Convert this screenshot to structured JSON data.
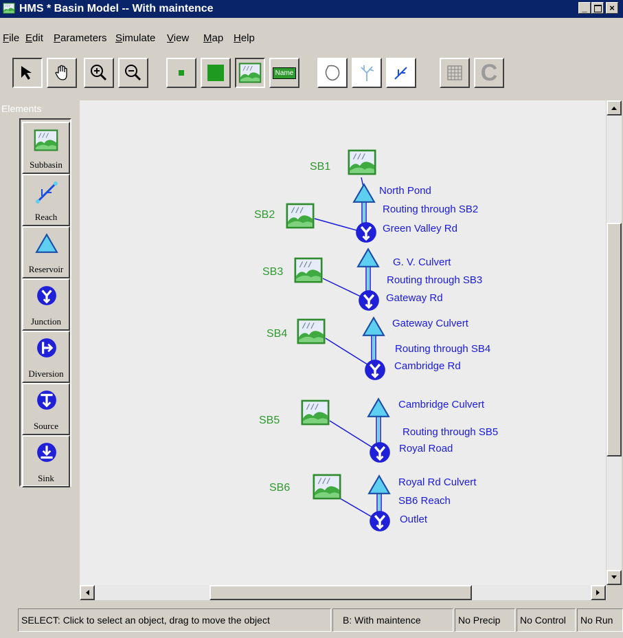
{
  "window": {
    "title": "HMS * Basin Model -- With maintence",
    "controls": [
      "minimize",
      "maximize",
      "close"
    ]
  },
  "menu": [
    "File",
    "Edit",
    "Parameters",
    "Simulate",
    "View",
    "Map",
    "Help"
  ],
  "toolbar": {
    "buttons": [
      "select-arrow",
      "pan-hand",
      "zoom-in",
      "zoom-out",
      "small-icons",
      "large-icons",
      "map-background",
      "name-labels",
      "basin-outline",
      "stream-network",
      "reach-lines",
      "grid",
      "clear"
    ],
    "name_label": "Name",
    "clear_label": "C"
  },
  "elements": {
    "label": "Elements",
    "items": [
      "Subbasin",
      "Reach",
      "Reservoir",
      "Junction",
      "Diversion",
      "Source",
      "Sink"
    ]
  },
  "basin": {
    "subbasins": [
      "SB1",
      "SB2",
      "SB3",
      "SB4",
      "SB5",
      "SB6"
    ],
    "reservoirs": [
      "North Pond",
      "G. V. Culvert",
      "Gateway Culvert",
      "Cambridge Culvert",
      "Royal Rd Culvert"
    ],
    "reaches": [
      "Routing through SB2",
      "Routing through SB3",
      "Routing through SB4",
      "Routing through SB5",
      "SB6 Reach"
    ],
    "junctions": [
      "Green Valley Rd",
      "Gateway Rd",
      "Cambridge Rd",
      "Royal Road",
      "Outlet"
    ]
  },
  "status": {
    "message": "SELECT: Click to select an object, drag to move the object",
    "basin": "B: With maintence",
    "precip": "No Precip",
    "control": "No Control",
    "run": "No Run"
  },
  "colors": {
    "titlebar": "#0a246a",
    "subbasin_label": "#2e9a2e",
    "element_label": "#1a1ae0",
    "junction": "#2020d8",
    "reservoir": "#5ecff0"
  }
}
